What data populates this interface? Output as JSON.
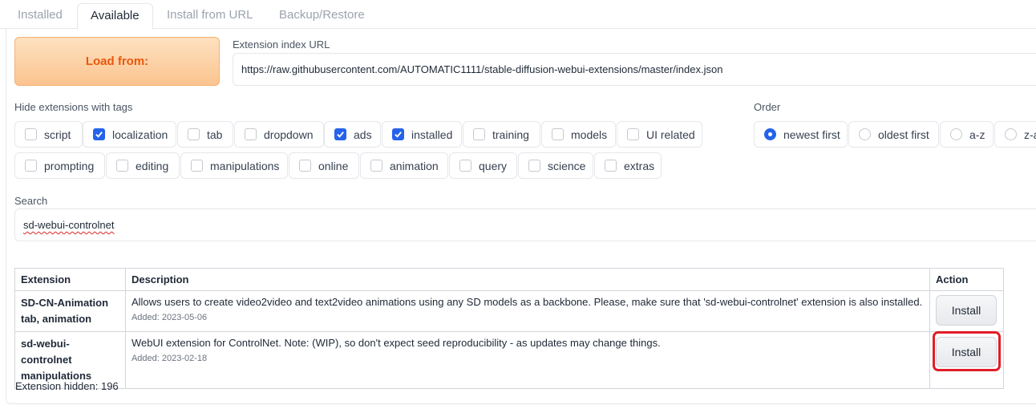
{
  "tabs": [
    "Installed",
    "Available",
    "Install from URL",
    "Backup/Restore"
  ],
  "load_button": "Load from:",
  "index_url": {
    "label": "Extension index URL",
    "value": "https://raw.githubusercontent.com/AUTOMATIC1111/stable-diffusion-webui-extensions/master/index.json"
  },
  "hide_tags": {
    "label": "Hide extensions with tags",
    "tags": [
      {
        "label": "script",
        "checked": false
      },
      {
        "label": "localization",
        "checked": true
      },
      {
        "label": "tab",
        "checked": false
      },
      {
        "label": "dropdown",
        "checked": false
      },
      {
        "label": "ads",
        "checked": true
      },
      {
        "label": "installed",
        "checked": true
      },
      {
        "label": "training",
        "checked": false
      },
      {
        "label": "models",
        "checked": false
      },
      {
        "label": "UI related",
        "checked": false
      },
      {
        "label": "prompting",
        "checked": false
      },
      {
        "label": "editing",
        "checked": false
      },
      {
        "label": "manipulations",
        "checked": false
      },
      {
        "label": "online",
        "checked": false
      },
      {
        "label": "animation",
        "checked": false
      },
      {
        "label": "query",
        "checked": false
      },
      {
        "label": "science",
        "checked": false
      },
      {
        "label": "extras",
        "checked": false
      }
    ]
  },
  "order": {
    "label": "Order",
    "options": [
      {
        "label": "newest first",
        "checked": true
      },
      {
        "label": "oldest first",
        "checked": false
      },
      {
        "label": "a-z",
        "checked": false
      },
      {
        "label": "z-a",
        "checked": false
      }
    ]
  },
  "search": {
    "label": "Search",
    "value": "sd-webui-controlnet"
  },
  "table": {
    "headers": [
      "Extension",
      "Description",
      "Action"
    ],
    "rows": [
      {
        "name": "SD-CN-Animation",
        "tags": "tab, animation",
        "description": "Allows users to create video2video and text2video animations using any SD models as a backbone. Please, make sure that 'sd-webui-controlnet' extension is also installed.",
        "added": "Added: 2023-05-06",
        "action": "Install"
      },
      {
        "name": "sd-webui-controlnet",
        "tags": "manipulations",
        "description": "WebUI extension for ControlNet. Note: (WIP), so don't expect seed reproducibility - as updates may change things.",
        "added": "Added: 2023-02-18",
        "action": "Install"
      }
    ]
  },
  "hidden_count": "Extension hidden: 196",
  "colors": {
    "accent": "#2563eb",
    "load_button": "#fbc48f",
    "highlight": "#e11d26"
  }
}
